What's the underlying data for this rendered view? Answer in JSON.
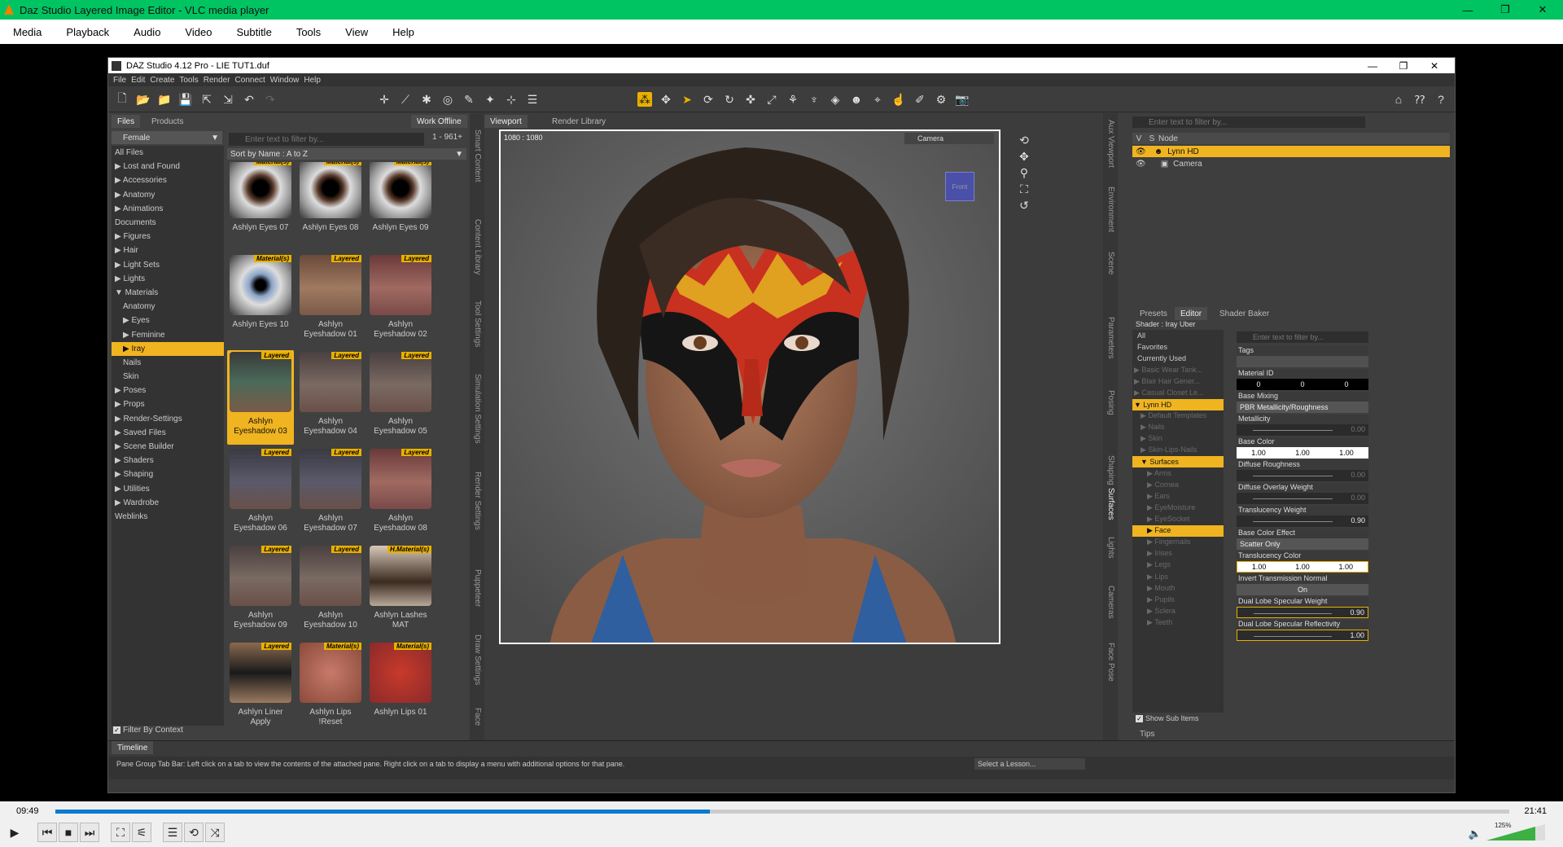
{
  "vlc": {
    "title": "Daz Studio Layered Image Editor - VLC media player",
    "menu": [
      "Media",
      "Playback",
      "Audio",
      "Video",
      "Subtitle",
      "Tools",
      "View",
      "Help"
    ],
    "elapsed": "09:49",
    "total": "21:41",
    "progress": 0.45,
    "volume": "125%"
  },
  "daz": {
    "title": "DAZ Studio 4.12 Pro - LIE TUT1.duf",
    "menu": [
      "File",
      "Edit",
      "Create",
      "Tools",
      "Render",
      "Connect",
      "Window",
      "Help"
    ]
  },
  "library": {
    "tabs": [
      "Files",
      "Products"
    ],
    "work_offline": "Work Offline",
    "category": "Female",
    "filter_placeholder": "Enter text to filter by...",
    "count": "1 - 961+",
    "sort": "Sort by Name : A to Z",
    "filter_by_context": "Filter By Context",
    "tree": [
      "All Files",
      "▶ Lost and Found",
      "▶ Accessories",
      "▶ Anatomy",
      "▶ Animations",
      "Documents",
      "▶ Figures",
      "▶ Hair",
      "▶ Light Sets",
      "▶ Lights",
      "▼ Materials",
      "Anatomy",
      "▶ Eyes",
      "▶ Feminine",
      "▶ Iray",
      "Nails",
      "Skin",
      "▶ Poses",
      "▶ Props",
      "▶ Render-Settings",
      "▶ Saved Files",
      "▶ Scene Builder",
      "▶ Shaders",
      "▶ Shaping",
      "▶ Utilities",
      "▶ Wardrobe",
      "Weblinks"
    ],
    "thumbs": [
      {
        "label": "Ashlyn Eyes 07",
        "badge": "Material(s)",
        "kind": "eye"
      },
      {
        "label": "Ashlyn Eyes 08",
        "badge": "Material(s)",
        "kind": "eye"
      },
      {
        "label": "Ashlyn Eyes 09",
        "badge": "Material(s)",
        "kind": "eye"
      },
      {
        "label": "Ashlyn Eyes 10",
        "badge": "Material(s)",
        "kind": "eyeblue"
      },
      {
        "label": "Ashlyn Eyeshadow 01",
        "badge": "Layered",
        "kind": "shadow1"
      },
      {
        "label": "Ashlyn Eyeshadow 02",
        "badge": "Layered",
        "kind": "shadow2"
      },
      {
        "label": "Ashlyn Eyeshadow 03",
        "badge": "Layered",
        "kind": "shadow3"
      },
      {
        "label": "Ashlyn Eyeshadow 04",
        "badge": "Layered",
        "kind": "shadow4"
      },
      {
        "label": "Ashlyn Eyeshadow 05",
        "badge": "Layered",
        "kind": "shadow4"
      },
      {
        "label": "Ashlyn Eyeshadow 06",
        "badge": "Layered",
        "kind": "shadow5"
      },
      {
        "label": "Ashlyn Eyeshadow 07",
        "badge": "Layered",
        "kind": "shadow5"
      },
      {
        "label": "Ashlyn Eyeshadow 08",
        "badge": "Layered",
        "kind": "shadow2"
      },
      {
        "label": "Ashlyn Eyeshadow 09",
        "badge": "Layered",
        "kind": "shadow4"
      },
      {
        "label": "Ashlyn Eyeshadow 10",
        "badge": "Layered",
        "kind": "shadow4"
      },
      {
        "label": "Ashlyn Lashes MAT",
        "badge": "H.Material(s)",
        "kind": "lash"
      },
      {
        "label": "Ashlyn Liner Apply",
        "badge": "Layered",
        "kind": "liner"
      },
      {
        "label": "Ashlyn Lips !Reset",
        "badge": "Material(s)",
        "kind": "lips1"
      },
      {
        "label": "Ashlyn Lips 01",
        "badge": "Material(s)",
        "kind": "lips2"
      }
    ]
  },
  "side_tabs_left": [
    "Smart Content",
    "Content Library",
    "Tool Settings",
    "Simulation Settings",
    "Render Settings",
    "Puppeteer",
    "Draw Settings",
    "Face"
  ],
  "viewport": {
    "tabs": [
      "Viewport",
      "Render Library"
    ],
    "resolution": "1080 : 1080",
    "camera": "Camera",
    "cube": "Front"
  },
  "side_tabs_right": [
    "Aux Viewport",
    "Environment",
    "Scene",
    "Parameters",
    "Posing",
    "Shaping",
    "Surfaces",
    "Lights",
    "Cameras",
    "Face Pose"
  ],
  "scene": {
    "filter_placeholder": "Enter text to filter by...",
    "head_v": "V",
    "head_s": "S",
    "head_node": "Node",
    "nodes": [
      "Lynn HD",
      "Camera"
    ]
  },
  "surfaces": {
    "tabs": [
      "Presets",
      "Editor",
      "Shader Baker"
    ],
    "shader": "Shader : Iray Uber",
    "filter_placeholder": "Enter text to filter by...",
    "show_sub": "Show Sub Items",
    "tree": [
      "All",
      "Favorites",
      "Currently Used",
      "▶ Basic Wear Tank...",
      "▶ Blair Hair Gener...",
      "▶ Casual Closet Le...",
      "▼ Lynn HD",
      "▶ Default Templates",
      "▶ Nails",
      "▶ Skin",
      "▶ Skin-Lips-Nails",
      "▼ Surfaces",
      "▶ Arms",
      "▶ Cornea",
      "▶ Ears",
      "▶ EyeMoisture",
      "▶ EyeSocket",
      "▶ Face",
      "▶ Fingernails",
      "▶ Irises",
      "▶ Legs",
      "▶ Lips",
      "▶ Mouth",
      "▶ Pupils",
      "▶ Sclera",
      "▶ Teeth"
    ],
    "props": {
      "tags": "Tags",
      "material_id": "Material ID",
      "mid_vals": [
        "0",
        "0",
        "0"
      ],
      "base_mixing": "Base Mixing",
      "base_mixing_val": "PBR Metallicity/Roughness",
      "metallicity": "Metallicity",
      "metallicity_val": "0.00",
      "base_color": "Base Color",
      "bc_vals": [
        "1.00",
        "1.00",
        "1.00"
      ],
      "diffuse_roughness": "Diffuse Roughness",
      "dr_val": "0.00",
      "diffuse_overlay": "Diffuse Overlay Weight",
      "do_val": "0.00",
      "translucency_weight": "Translucency Weight",
      "tw_val": "0.90",
      "base_color_effect": "Base Color Effect",
      "bce_val": "Scatter Only",
      "translucency_color": "Translucency Color",
      "tc_vals": [
        "1.00",
        "1.00",
        "1.00"
      ],
      "invert_normal": "Invert Transmission Normal",
      "invert_val": "On",
      "dlsw": "Dual Lobe Specular Weight",
      "dlsw_val": "0.90",
      "dlsr": "Dual Lobe Specular Reflectivity",
      "dlsr_val": "1.00"
    }
  },
  "timeline": "Timeline",
  "tips": "Tips",
  "status": "Pane Group Tab Bar: Left click on a tab to view the contents of the attached pane. Right click on a tab to display a menu with additional options for that pane.",
  "lesson": "Select a Lesson..."
}
